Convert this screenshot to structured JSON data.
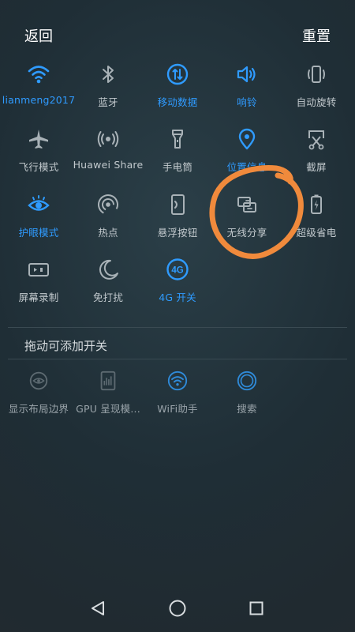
{
  "header": {
    "back_label": "返回",
    "reset_label": "重置"
  },
  "tiles": [
    {
      "label": "lianmeng2017",
      "icon": "wifi-icon",
      "state": "on"
    },
    {
      "label": "蓝牙",
      "icon": "bluetooth-icon",
      "state": "off"
    },
    {
      "label": "移动数据",
      "icon": "mobile-data-icon",
      "state": "on"
    },
    {
      "label": "响铃",
      "icon": "sound-icon",
      "state": "on"
    },
    {
      "label": "自动旋转",
      "icon": "auto-rotate-icon",
      "state": "off"
    },
    {
      "label": "飞行模式",
      "icon": "airplane-icon",
      "state": "off"
    },
    {
      "label": "Huawei Share",
      "icon": "huawei-share-icon",
      "state": "off"
    },
    {
      "label": "手电筒",
      "icon": "flashlight-icon",
      "state": "off"
    },
    {
      "label": "位置信息",
      "icon": "location-icon",
      "state": "on"
    },
    {
      "label": "截屏",
      "icon": "screenshot-icon",
      "state": "off"
    },
    {
      "label": "护眼模式",
      "icon": "eye-comfort-icon",
      "state": "on"
    },
    {
      "label": "热点",
      "icon": "hotspot-icon",
      "state": "off"
    },
    {
      "label": "悬浮按钮",
      "icon": "floating-button-icon",
      "state": "off"
    },
    {
      "label": "无线分享",
      "icon": "wireless-share-icon",
      "state": "off"
    },
    {
      "label": "超级省电",
      "icon": "battery-saver-icon",
      "state": "off"
    },
    {
      "label": "屏幕录制",
      "icon": "screen-record-icon",
      "state": "off"
    },
    {
      "label": "免打扰",
      "icon": "do-not-disturb-icon",
      "state": "off"
    },
    {
      "label": "4G 开关",
      "icon": "4g-icon",
      "icon_text": "4G",
      "state": "on"
    }
  ],
  "addable": {
    "title": "拖动可添加开关",
    "items": [
      {
        "label": "显示布局边界",
        "icon": "layout-bounds-icon"
      },
      {
        "label": "GPU 呈现模...",
        "icon": "gpu-render-icon"
      },
      {
        "label": "WiFi助手",
        "icon": "wifi-assistant-icon"
      },
      {
        "label": "搜索",
        "icon": "search-icon"
      }
    ]
  },
  "colors": {
    "accent": "#2f9bff",
    "icon_off": "#a9b2b7",
    "annotation": "#f08a3c"
  },
  "navbar": {
    "back": "nav-back-icon",
    "home": "nav-home-icon",
    "recents": "nav-recents-icon"
  }
}
